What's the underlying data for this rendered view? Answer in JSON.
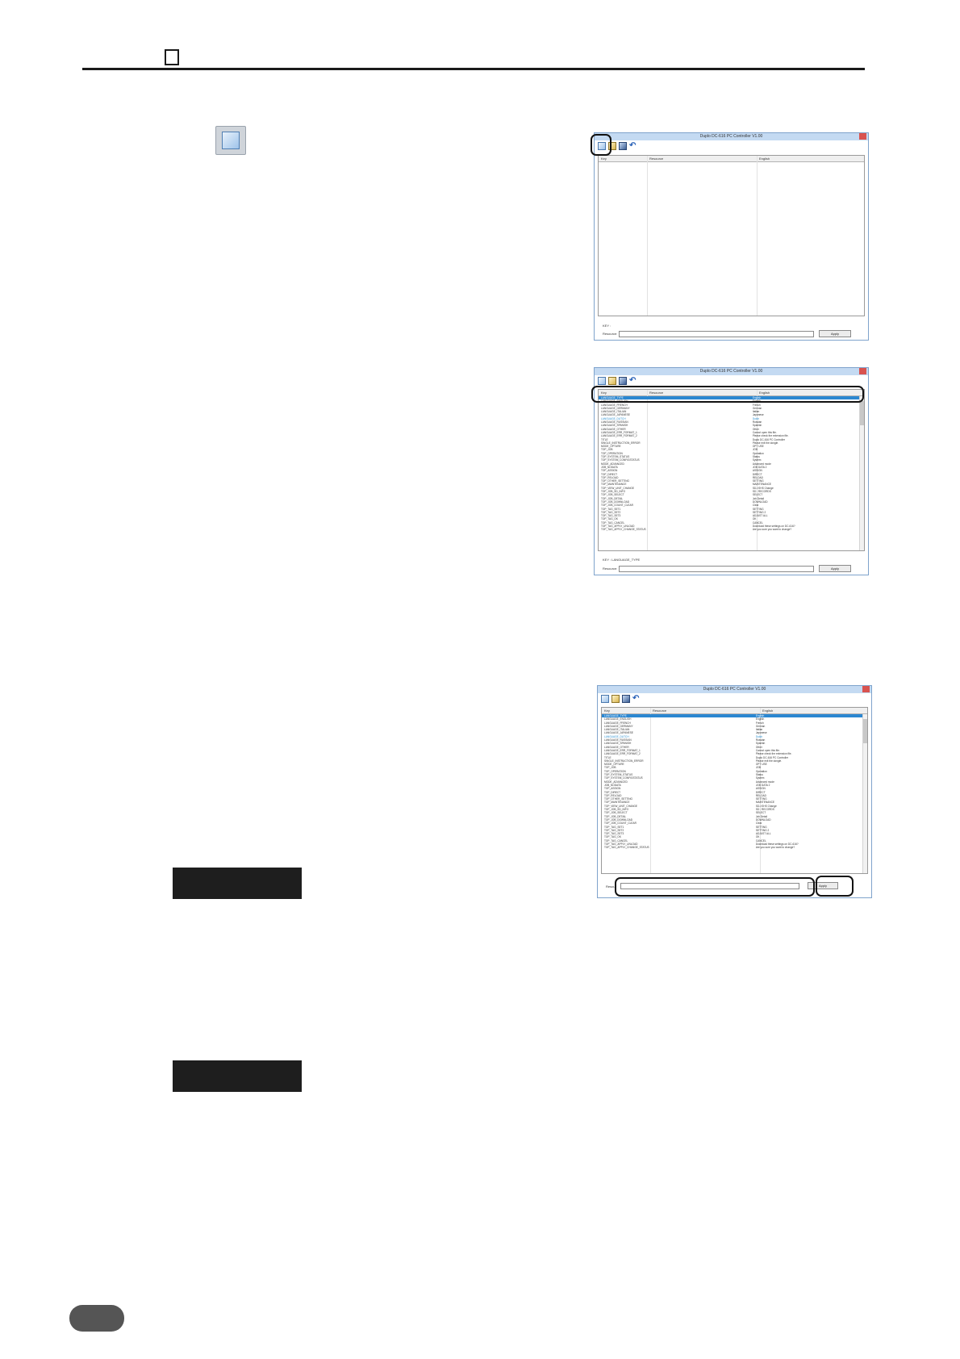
{
  "screens": {
    "one": {
      "title": "Duplo DC-616 PC Controller V1.00",
      "col_key": "Key",
      "col_resource": "Resource",
      "col_english": "English",
      "key_label": "KEY :",
      "resource_label": "Resource:",
      "apply_label": "Apply"
    },
    "two": {
      "title": "Duplo DC-616 PC Controller V1.00",
      "col_key": "Key",
      "col_resource": "Resource",
      "col_english": "English",
      "key_label": "KEY : LANGUAGE_TYPE",
      "resource_label": "Resource:",
      "apply_label": "Apply",
      "rows": [
        {
          "k": "LANGUAGE_TYPE",
          "e": "English"
        },
        {
          "k": "LANGUAGE_ENGLISH",
          "e": "English"
        },
        {
          "k": "LANGUAGE_FRENCH",
          "e": "French"
        },
        {
          "k": "LANGUAGE_GERMANY",
          "e": "German"
        },
        {
          "k": "LANGUAGE_ITALIAN",
          "e": "Italian"
        },
        {
          "k": "LANGUAGE_JAPANESE",
          "e": "Japanese"
        },
        {
          "k": "LANGUAGE_DUTCH",
          "e": "Dutch"
        },
        {
          "k": "LANGUAGE_RUSSIAN",
          "e": "Russian"
        },
        {
          "k": "LANGUAGE_SPANISH",
          "e": "Spanish"
        },
        {
          "k": "LANGUAGE_OTHER",
          "e": "Other"
        },
        {
          "k": "LANGUAGE_ERR_FORMAT_1",
          "e": "Cannot open this file."
        },
        {
          "k": "LANGUAGE_ERR_FORMAT_2",
          "e": "Please check the extension file."
        },
        {
          "k": "TITLE",
          "e": "Duplo DC-616 PC Controller"
        },
        {
          "k": "SINGLE_INSTRUCTION_ERROR",
          "e": "Please exit the dongle."
        },
        {
          "k": "MODE_OPTURE",
          "e": "OPT USE"
        },
        {
          "k": "TOP_JOB",
          "e": "JOB"
        },
        {
          "k": "TOP_OPERATION",
          "e": "Operation"
        },
        {
          "k": "TOP_SYSTEM_STATUS",
          "e": "Status"
        },
        {
          "k": "TOP_SYSTEM_CONFIGSTATUS",
          "e": "System"
        },
        {
          "k": "MODE_ADVANCED",
          "e": "Advanced mode"
        },
        {
          "k": "JOB_NODATA",
          "e": "JOB DATA 2"
        },
        {
          "k": "TOP_ASSIGN",
          "e": "ASSIGN"
        },
        {
          "k": "TOP_DIRECT",
          "e": "DIRECT"
        },
        {
          "k": "TOP_RELOAD",
          "e": "RELOAD"
        },
        {
          "k": "TOP_OTHER_SETTING",
          "e": "SETTING"
        },
        {
          "k": "TOP_MAINTENANCE",
          "e": "MAINTENANCE"
        },
        {
          "k": "TOP_VIEW_UNIT_CHANGE",
          "e": "SD->SHS Change"
        },
        {
          "k": "TOP_JOB_SD_INFO",
          "e": "SD : RECORDS"
        },
        {
          "k": "TOP_JOB_SELECT",
          "e": "SELECT"
        },
        {
          "k": "TOP_JOB_DETAIL",
          "e": "Job Detail"
        },
        {
          "k": "TOP_JOB_DOWNLOAD",
          "e": "DOWNLOAD"
        },
        {
          "k": "TOP_JOB_COUNT_CLEAR",
          "e": "Clear"
        },
        {
          "k": "TOP_TAG_SET1",
          "e": "SETTING"
        },
        {
          "k": "TOP_TAG_SET2",
          "e": "SETTING 2"
        },
        {
          "k": "TOP_TAG_SET3",
          "e": "ADJUST ALL"
        },
        {
          "k": "TOP_TAG_OK",
          "e": "OK"
        },
        {
          "k": "TOP_TAG_CANCEL",
          "e": "CANCEL"
        },
        {
          "k": "TOP_TAG_APPLY_UNLOAD",
          "e": "Download these settings on DC-616?"
        },
        {
          "k": "TOP_TAG_APPLY_CHANGE_STATUS",
          "e": "Are you sure you want to change?"
        }
      ]
    },
    "three": {
      "title": "Duplo DC-616 PC Controller V1.00",
      "col_key": "Key",
      "col_resource": "Resource",
      "col_english": "English",
      "resource_label": "Resour",
      "apply_label": "Apply"
    }
  },
  "icons": {
    "new_file": "new-file-icon",
    "open": "open-folder-icon",
    "save": "save-icon",
    "undo": "undo-icon"
  },
  "colors": {
    "selection": "#2b87d1",
    "titlebar": "#c4daf2",
    "highlight_text": "#2a8fcf"
  }
}
